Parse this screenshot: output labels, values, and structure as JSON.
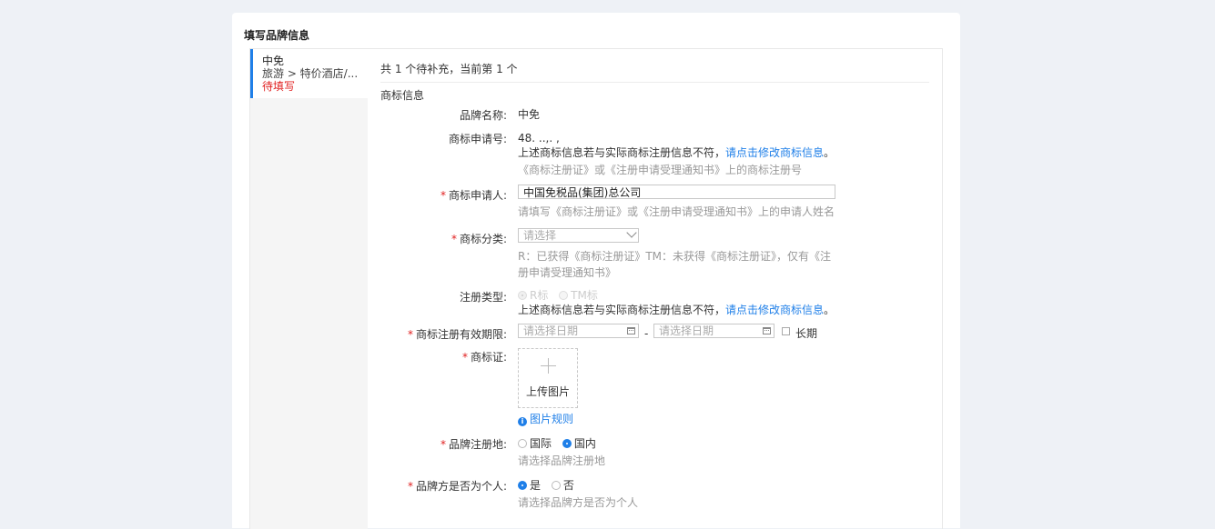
{
  "card": {
    "title": "填写品牌信息"
  },
  "sidebar": {
    "item": {
      "name": "中免",
      "category": "旅游 > 特价酒店/...",
      "status": "待填写"
    }
  },
  "progress": "共 1 个待补充，当前第 1 个",
  "section_title": "商标信息",
  "fields": {
    "brand_name": {
      "label": "品牌名称:",
      "value": "中免"
    },
    "app_no": {
      "label": "商标申请号:",
      "value": "48.  ..,. ,",
      "notice": "上述商标信息若与实际商标注册信息不符，",
      "link": "请点击修改商标信息",
      "notice_end": "。",
      "hint": "《商标注册证》或《注册申请受理通知书》上的商标注册号"
    },
    "applicant": {
      "label": "商标申请人:",
      "value": "中国免税品(集团)总公司",
      "hint": "请填写《商标注册证》或《注册申请受理通知书》上的申请人姓名"
    },
    "category": {
      "label": "商标分类:",
      "placeholder": "请选择",
      "hint_line1": "R：已获得《商标注册证》TM：未获得《商标注册证》，仅有《注",
      "hint_line2": "册申请受理通知书》"
    },
    "reg_type": {
      "label": "注册类型:",
      "options": [
        "R标",
        "TM标"
      ],
      "notice": "上述商标信息若与实际商标注册信息不符，",
      "link": "请点击修改商标信息",
      "notice_end": "。"
    },
    "validity": {
      "label": "商标注册有效期限:",
      "start_placeholder": "请选择日期",
      "separator": "-",
      "end_placeholder": "请选择日期",
      "long_term": "长期"
    },
    "certificate": {
      "label": "商标证:",
      "upload_label": "上传图片",
      "rules_link": "图片规则"
    },
    "reg_place": {
      "label": "品牌注册地:",
      "options": [
        "国际",
        "国内"
      ],
      "selected": "国内",
      "hint": "请选择品牌注册地"
    },
    "is_personal": {
      "label": "品牌方是否为个人:",
      "options": [
        "是",
        "否"
      ],
      "selected": "是",
      "hint": "请选择品牌方是否为个人"
    }
  },
  "colors": {
    "accent": "#1f7fe8",
    "required": "#e02020",
    "hint": "#999999"
  }
}
